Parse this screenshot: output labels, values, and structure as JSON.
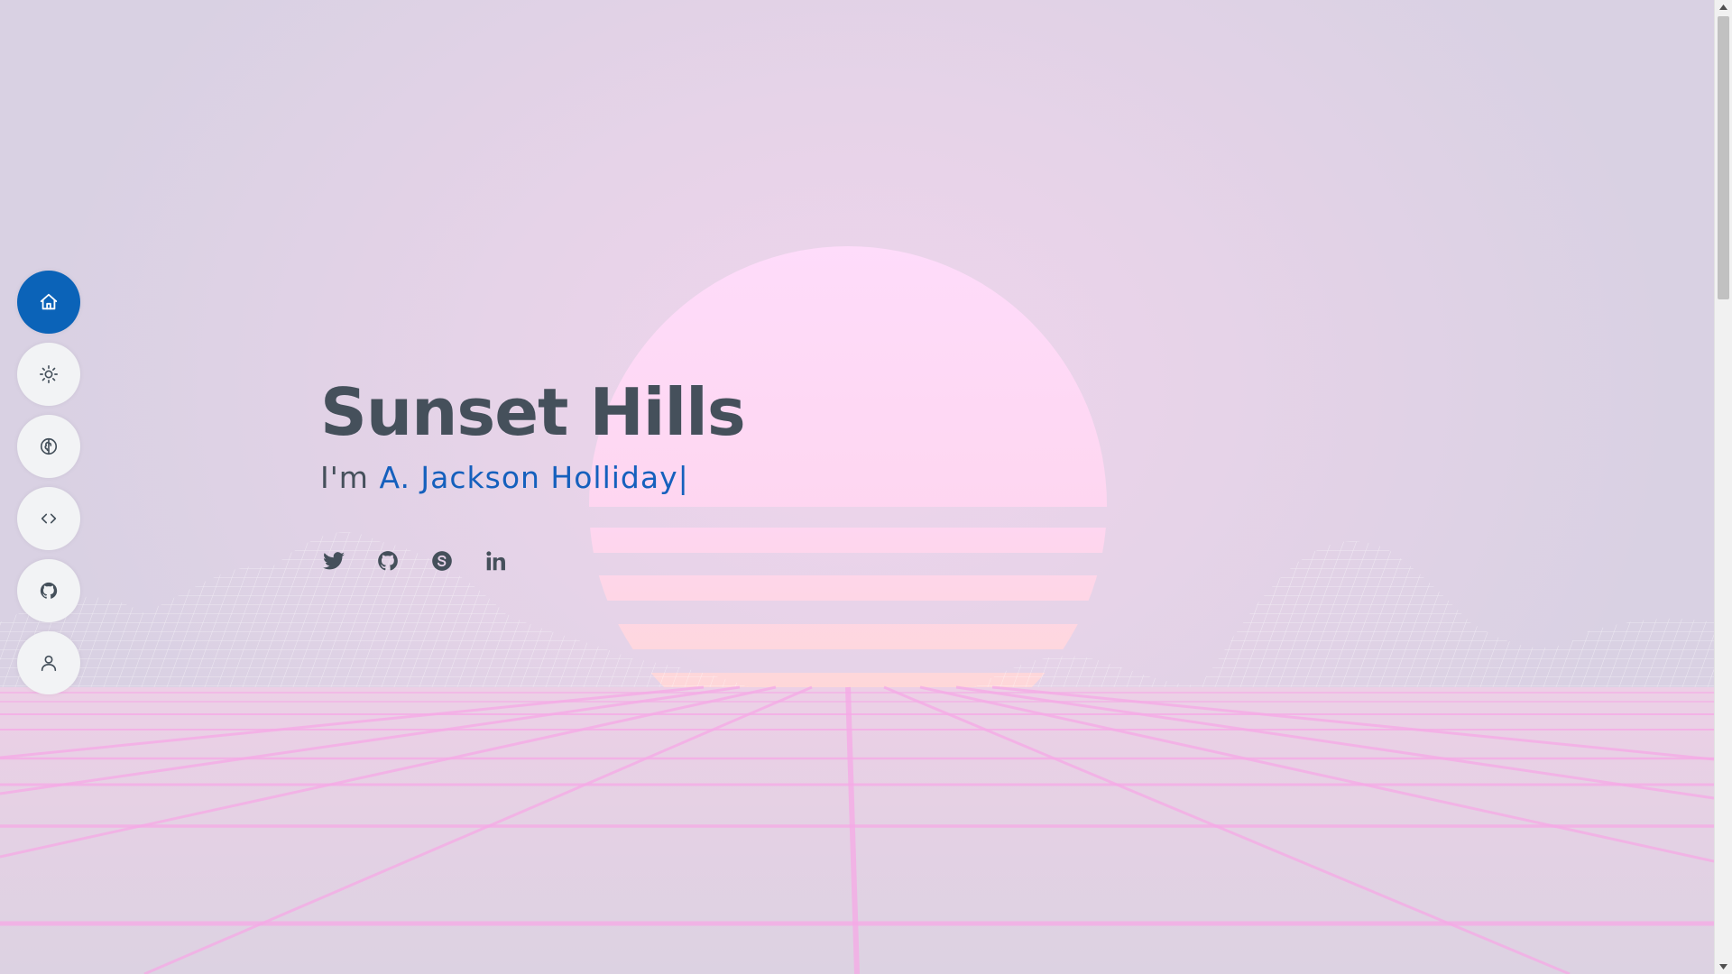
{
  "hero": {
    "title": "Sunset Hills",
    "greeting": "I'm",
    "name": "A. Jackson Holliday",
    "cursor": "|"
  },
  "sidebar": {
    "items": [
      {
        "icon": "home-icon",
        "active": true
      },
      {
        "icon": "sun-icon",
        "active": false
      },
      {
        "icon": "brain-icon",
        "active": false
      },
      {
        "icon": "code-icon",
        "active": false
      },
      {
        "icon": "github-icon",
        "active": false
      },
      {
        "icon": "person-icon",
        "active": false
      }
    ]
  },
  "social": {
    "links": [
      {
        "icon": "twitter-icon"
      },
      {
        "icon": "github-icon"
      },
      {
        "icon": "skype-icon"
      },
      {
        "icon": "linkedin-icon"
      }
    ]
  },
  "colors": {
    "accent": "#0b63b8",
    "title": "#45505b",
    "typed": "#1560bd",
    "grid": "#f6a8e6",
    "sun_top": "#ffdafa",
    "sun_bottom": "#ffd9cc"
  }
}
